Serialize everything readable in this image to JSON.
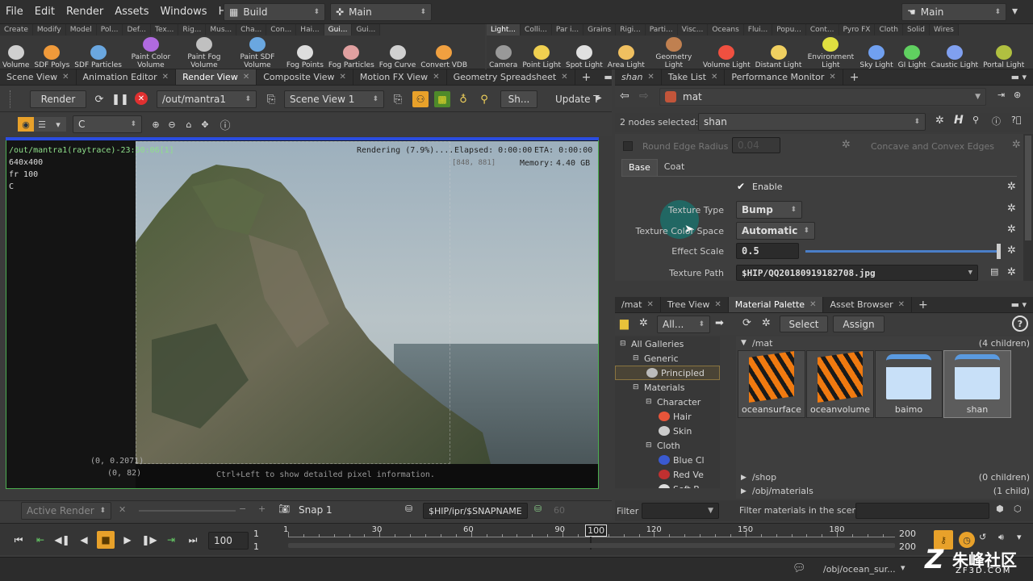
{
  "menubar": {
    "items": [
      "File",
      "Edit",
      "Render",
      "Assets",
      "Windows",
      "Help"
    ],
    "desktop_left": "Build",
    "desktop_mid": "Main",
    "desktop_right": "Main"
  },
  "shelf_left": {
    "tabs": [
      "Create",
      "Modify",
      "Model",
      "Pol...",
      "Def...",
      "Tex...",
      "Rig...",
      "Mus...",
      "Cha...",
      "Con...",
      "Hai...",
      "Gui...",
      "Gui..."
    ],
    "tools": [
      "Volume",
      "SDF Polys",
      "SDF Particles",
      "Paint Color Volume",
      "Paint Fog Volume",
      "Paint SDF Volume",
      "Fog Points",
      "Fog Particles",
      "Fog Curve",
      "Convert VDB"
    ]
  },
  "shelf_right": {
    "tabs": [
      "Light...",
      "Colli...",
      "Par i...",
      "Grains",
      "Rigi...",
      "Parti...",
      "Visc...",
      "Oceans",
      "Flui...",
      "Popu...",
      "Cont...",
      "Pyro FX",
      "Cloth",
      "Solid",
      "Wires"
    ],
    "tools": [
      "Camera",
      "Point Light",
      "Spot Light",
      "Area Light",
      "Geometry Light",
      "Volume Light",
      "Distant Light",
      "Environment Light",
      "Sky Light",
      "GI Light",
      "Caustic Light",
      "Portal Light"
    ]
  },
  "left_pane": {
    "tabs": [
      "Scene View",
      "Animation Editor",
      "Render View",
      "Composite View",
      "Motion FX View",
      "Geometry Spreadsheet"
    ],
    "toolbar": {
      "render_label": "Render",
      "rop_path": "/out/mantra1",
      "camera": "Scene View 1",
      "sh": "Sh...",
      "update": "Update T"
    },
    "toolbar2": {
      "channel": "C"
    },
    "viewport": {
      "title": "/out/mantra1(raytrace)-23:50:06[1]",
      "resolution": "640x400",
      "frame": "fr 100",
      "channel": "C",
      "rendering": "Rendering (7.9%)....",
      "elapsed": "Elapsed: 0:00:00",
      "eta": "ETA: 0:00:00",
      "memory_label": "Memory:",
      "memory_value": "4.40 GB",
      "coords": "[848, 881]",
      "pixel_value": "(0, 0.2071)",
      "pixel_coord": "(0, 82)",
      "hint": "Ctrl+Left to show detailed pixel information."
    },
    "bottombar": {
      "active_render": "Active Render",
      "snap": "Snap 1",
      "snap_path": "$HIP/ipr/$SNAPNAME",
      "snap_count": "60"
    }
  },
  "params_pane": {
    "tabs": [
      "shan",
      "Take List",
      "Performance Monitor"
    ],
    "path": "mat",
    "nodes_selected_label": "2 nodes selected:",
    "nodes_selected_value": "shan",
    "round_edge_label": "Round Edge Radius",
    "round_edge_value": "0.04",
    "concave_label": "Concave and Convex Edges",
    "subtabs": [
      "Base",
      "Coat"
    ],
    "enable_label": "Enable",
    "texture_type_label": "Texture Type",
    "texture_type_value": "Bump",
    "color_space_label": "Texture Color Space",
    "color_space_value": "Automatic",
    "effect_scale_label": "Effect Scale",
    "effect_scale_value": "0.5",
    "effect_scale_fraction": 1.0,
    "texture_path_label": "Texture Path",
    "texture_path_value": "$HIP/QQ20180919182708.jpg"
  },
  "material_pane": {
    "tabs": [
      "/mat",
      "Tree View",
      "Material Palette",
      "Asset Browser"
    ],
    "filter_all": "All...",
    "select_label": "Select",
    "assign_label": "Assign",
    "tree": [
      "All Galleries",
      "Generic",
      "Principled",
      "Materials",
      "Character",
      "Hair",
      "Skin",
      "Cloth",
      "Blue Cl",
      "Red Ve",
      "Soft B"
    ],
    "mat_section": "/mat",
    "mat_count": "(4 children)",
    "materials": [
      "oceansurface",
      "oceanvolume",
      "baimo",
      "shan"
    ],
    "shop_section": "/shop",
    "shop_count": "(0 children)",
    "obj_section": "/obj/materials",
    "obj_count": "(1 child)",
    "filter_label": "Filter",
    "filter_scene_label": "Filter materials in the scene:"
  },
  "timeline": {
    "current_frame": "100",
    "start": "1",
    "start2": "1",
    "ticks": [
      "1",
      "30",
      "60",
      "90",
      "100",
      "120",
      "150",
      "180"
    ],
    "end": "200",
    "end2": "200",
    "status_path": "/obj/ocean_sur...",
    "frame_range_max": 200,
    "current_frame_value": 100
  },
  "watermark": {
    "text": "朱峰社区",
    "sub": "ZF3D.COM"
  },
  "colors": {
    "accent_green": "#4caf50",
    "accent_blue": "#2a4de0",
    "orange": "#e8a12a"
  }
}
